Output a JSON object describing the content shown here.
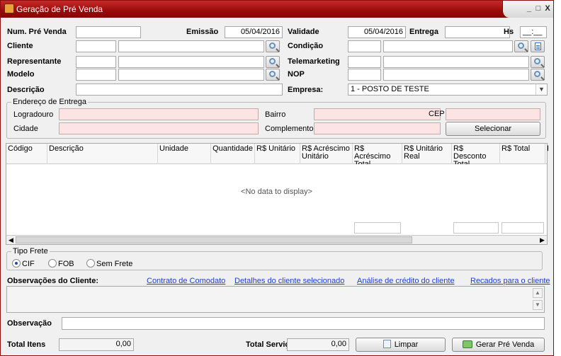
{
  "window": {
    "title": "Geração de Pré Venda",
    "minimize": "_",
    "maximize": "□",
    "close": "X"
  },
  "form": {
    "num_pre_venda_label": "Num. Pré Venda",
    "num_pre_venda_value": "",
    "emissao_label": "Emissão",
    "emissao_value": "05/04/2016",
    "validade_label": "Validade",
    "validade_value": "05/04/2016",
    "entrega_label": "Entrega",
    "entrega_value": "",
    "hs_label": "Hs",
    "hs_value": "__:__",
    "cliente_label": "Cliente",
    "condicao_label": "Condição",
    "representante_label": "Representante",
    "telemarketing_label": "Telemarketing",
    "modelo_label": "Modelo",
    "nop_label": "NOP",
    "descricao_label": "Descrição",
    "empresa_label": "Empresa:",
    "empresa_value": "1 - POSTO DE TESTE"
  },
  "endereco": {
    "group_title": "Endereço de Entrega",
    "logradouro_label": "Logradouro",
    "bairro_label": "Bairro",
    "cep_label": "CEP",
    "cidade_label": "Cidade",
    "complemento_label": "Complemento",
    "selecionar_label": "Selecionar"
  },
  "grid": {
    "columns": [
      "Código",
      "Descrição",
      "Unidade",
      "Quantidade",
      "R$ Unitário",
      "R$ Acréscimo Unitário",
      "R$ Acréscimo Total",
      "R$ Unitário Real",
      "R$ Desconto Total",
      "R$ Total",
      "I"
    ],
    "empty_text": "<No data to display>",
    "scroll_left": "◀",
    "scroll_right": "▶"
  },
  "frete": {
    "group_title": "Tipo Frete",
    "options": [
      "CIF",
      "FOB",
      "Sem Frete"
    ],
    "selected": "CIF"
  },
  "obs_cliente": {
    "label": "Observações do Cliente:",
    "links": [
      "Contrato de Comodato",
      "Detalhes do cliente selecionado",
      "Análise de crédito do cliente",
      "Recados para o cliente"
    ],
    "scroll_up": "▲",
    "scroll_down": "▼"
  },
  "observacao": {
    "label": "Observação",
    "value": ""
  },
  "totals": {
    "total_itens_label": "Total Itens",
    "total_itens_value": "0,00",
    "total_servicos_label": "Total Serviços",
    "total_servicos_value": "0,00",
    "limpar_label": "Limpar",
    "gerar_label": "Gerar Pré Venda"
  },
  "colors": {
    "title_red": "#9b0a0a",
    "required_pink": "#fde4e4",
    "link_blue": "#1a3fd1"
  }
}
